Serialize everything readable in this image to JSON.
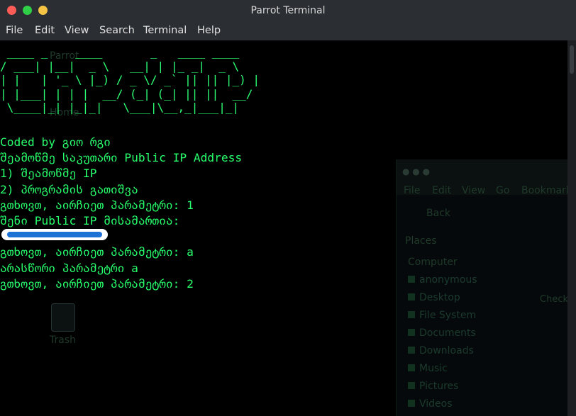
{
  "window": {
    "title": "Parrot Terminal"
  },
  "menu": [
    "File",
    "Edit",
    "View",
    "Search",
    "Terminal",
    "Help"
  ],
  "colors": {
    "terminal_text": "#28ff6c",
    "background": "#000000",
    "titlebar": "#2b2e33",
    "redaction_bar": "#1e72d6"
  },
  "banner": [
    " ____ _    ____       _   ____ ____",
    "/ ___| |__|  _ \\   __| | |_ _|  _ \\",
    "| |   | '_ \\ |_) / _ \\/ _` || || |_) |",
    "| |___| | | |  __/ (_| (_| || ||  __/",
    " \\____|_| |_|_|   \\___|\\__,_|___|_|"
  ],
  "lines": [
    "Coded by გიო რგი",
    "შეამოწმე საკუთარი Public IP Address",
    "1) შეამოწმე IP",
    "2) პროგრამის გათიშვა",
    "გთხოვთ, აირჩიეთ პარამეტრი: 1",
    "შენი Public IP მისამართია:",
    "",
    "გთხოვთ, აირჩიეთ პარამეტრი: a",
    "არასწორი პარამეტრი a",
    "გთხოვთ, აირჩიეთ პარამეტრი: 2"
  ],
  "desktop_ghost": {
    "parrot_label": "Parrot",
    "home_label": "Home",
    "trash_label": "Trash",
    "fm_menu": [
      "File",
      "Edit",
      "View",
      "Go",
      "Bookmarks"
    ],
    "fm_back": "Back",
    "fm_places": "Places",
    "fm_computer": "Computer",
    "fm_items": [
      "anonymous",
      "Desktop",
      "File System",
      "Documents",
      "Downloads",
      "Music",
      "Pictures",
      "Videos"
    ],
    "fm_check": "Check"
  }
}
